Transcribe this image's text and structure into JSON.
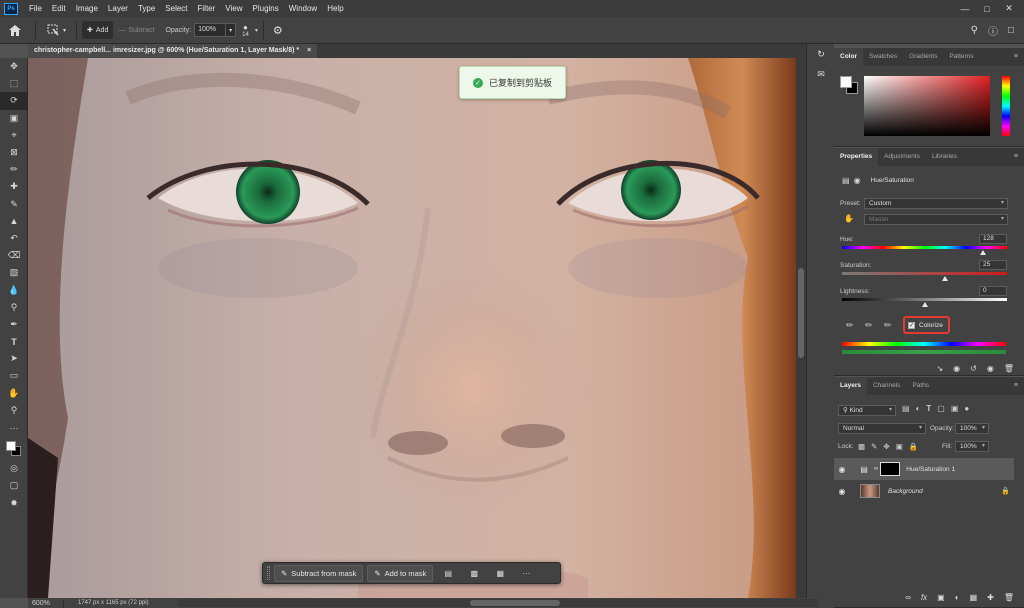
{
  "menu": {
    "logo": "Ps",
    "items": [
      "File",
      "Edit",
      "Image",
      "Layer",
      "Type",
      "Select",
      "Filter",
      "View",
      "Plugins",
      "Window",
      "Help"
    ],
    "window_controls": [
      "—",
      "□",
      "✕"
    ]
  },
  "options": {
    "add_label": "Add",
    "subtract_label": "Subtract",
    "opacity_label": "Opacity:",
    "opacity_value": "100%",
    "brush_size": "14"
  },
  "document": {
    "tab_title": "christopher-campbell... imresizer.jpg @ 600% (Hue/Saturation 1, Layer Mask/8) *",
    "close_glyph": "×"
  },
  "toast": {
    "message": "已复制到剪贴板",
    "icon": "check-circle-icon"
  },
  "taskbar": {
    "subtract_label": "Subtract from mask",
    "add_label": "Add to mask",
    "more": "···"
  },
  "status": {
    "zoom": "600%",
    "info": "1747 px x 1165 px (72 ppi)"
  },
  "color_panel": {
    "tabs": [
      "Color",
      "Swatches",
      "Gradients",
      "Patterns"
    ],
    "active_tab": "Color"
  },
  "properties": {
    "tabs": [
      "Properties",
      "Adjustments",
      "Libraries"
    ],
    "title": "Hue/Saturation",
    "preset_label": "Preset:",
    "preset_value": "Custom",
    "channel_value": "Master",
    "hue_label": "Hue:",
    "hue_value": "128",
    "hue_position": 0.855,
    "saturation_label": "Saturation:",
    "saturation_value": "25",
    "saturation_position": 0.625,
    "lightness_label": "Lightness:",
    "lightness_value": "0",
    "lightness_position": 0.5,
    "colorize_label": "Colorize",
    "colorize_checked": true,
    "highlight_color": "#e53935"
  },
  "layers": {
    "tabs": [
      "Layers",
      "Channels",
      "Paths"
    ],
    "kind_label": "Kind",
    "blend_mode": "Normal",
    "opacity_label": "Opacity:",
    "opacity_value": "100%",
    "lock_label": "Lock:",
    "fill_label": "Fill:",
    "fill_value": "100%",
    "items": [
      {
        "name": "Hue/Saturation 1",
        "selected": true
      },
      {
        "name": "Background",
        "selected": false,
        "locked": true
      }
    ]
  },
  "colors": {
    "accent": "#31a8ff",
    "toast_green": "#35a853",
    "eye_green": "#1f8a4c"
  }
}
